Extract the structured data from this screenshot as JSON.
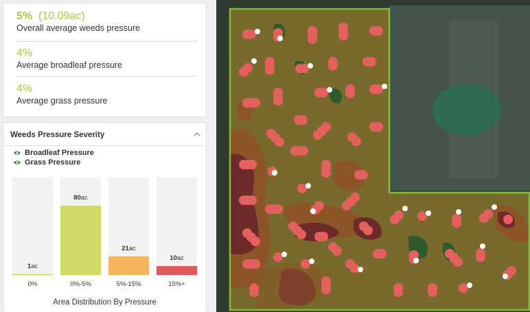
{
  "summary": {
    "overall": {
      "percent": "5%",
      "acres": "(10.09ac)",
      "label": "Overall average weeds pressure"
    },
    "broadleaf": {
      "percent": "4%",
      "label": "Average broadleaf pressure"
    },
    "grass": {
      "percent": "4%",
      "label": "Average grass pressure"
    }
  },
  "severity": {
    "title": "Weeds Pressure Severity",
    "legend": [
      {
        "label": "Broadleaf Pressure",
        "icon": "eye-icon"
      },
      {
        "label": "Grass Pressure",
        "icon": "eye-icon"
      }
    ],
    "distribution_title": "Area Distribution By Pressure"
  },
  "chart_data": {
    "type": "bar",
    "title": "Area Distribution By Pressure",
    "categories": [
      "0%",
      "0%-5%",
      "5%-15%",
      "15%+"
    ],
    "values": [
      1,
      80,
      21,
      10
    ],
    "value_labels": [
      "1",
      "80",
      "21",
      "10"
    ],
    "unit": "ac",
    "colors": [
      "#b5c94b",
      "#cfd966",
      "#f5b45c",
      "#e0585f"
    ],
    "ylim": [
      0,
      80
    ]
  },
  "map": {
    "colors": {
      "field_border": "#7bbf3a",
      "field_fill": "#7a6a2c",
      "high_pressure": "#6e2a2a",
      "medium_pressure": "#8b5528",
      "grass_patch": "#2f5a2c",
      "broadleaf_marker": "#e4605f",
      "grass_marker": "#ffffff"
    }
  }
}
